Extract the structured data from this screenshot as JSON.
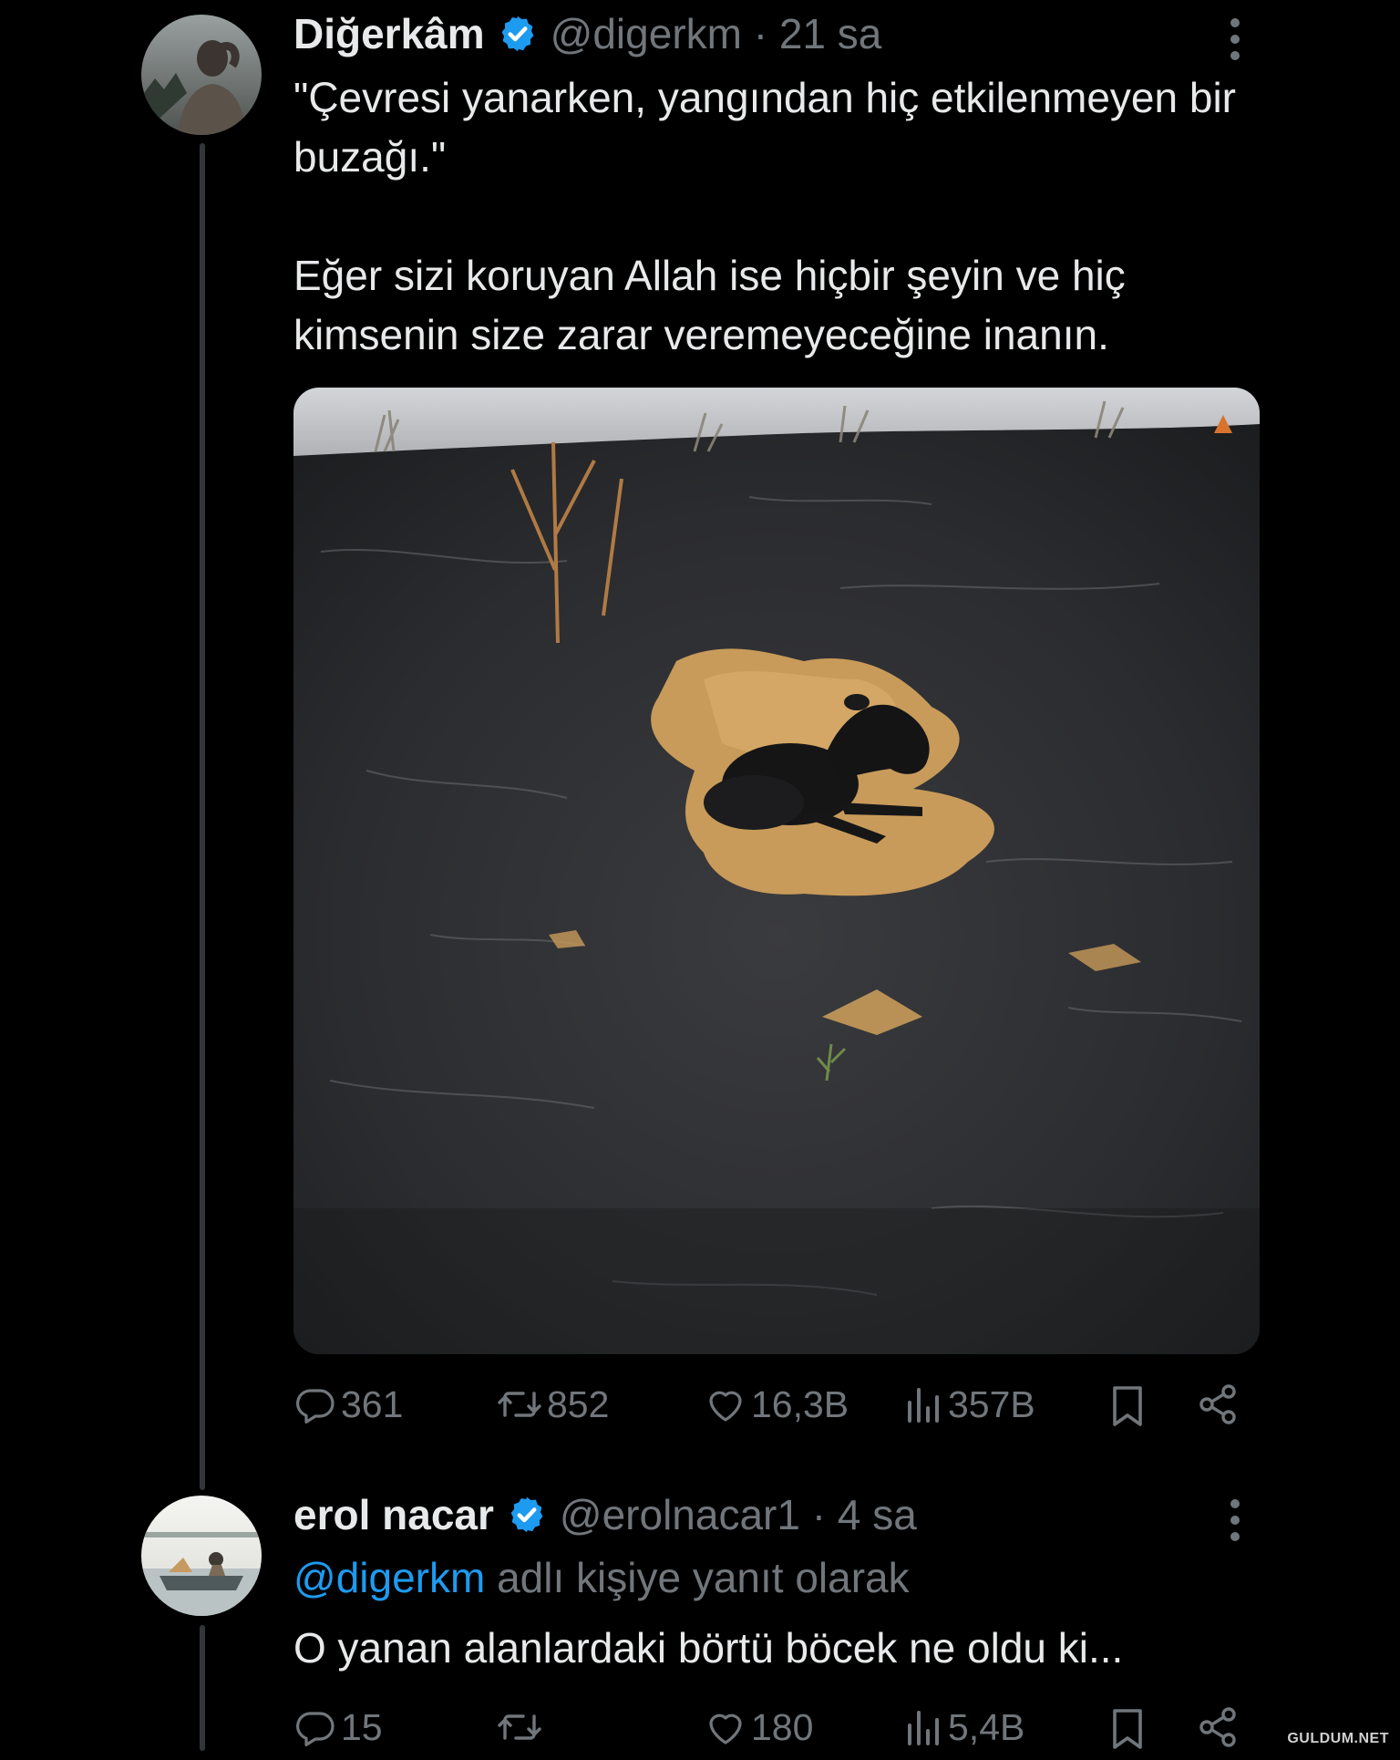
{
  "tweets": [
    {
      "display_name": "Diğerkâm",
      "handle_time": "@digerkm · 21 sa",
      "paragraphs": [
        "\"Çevresi yanarken, yangından hiç etkilenmeyen bir buzağı.\"",
        "Eğer sizi koruyan Allah ise hiçbir şeyin ve hiç kimsenin size zarar veremeyeceğine inanın."
      ],
      "media_icon": "burnt-field-calf-photo",
      "stats": {
        "replies": "361",
        "reposts": "852",
        "likes": "16,3B",
        "views": "357B"
      }
    },
    {
      "display_name": "erol nacar",
      "handle_time": "@erolnacar1 · 4 sa",
      "reply_to_mention": "@digerkm",
      "reply_to_suffix": " adlı kişiye yanıt olarak",
      "text": "O yanan alanlardaki börtü böcek ne oldu ki...",
      "stats": {
        "replies": "15",
        "reposts": "",
        "likes": "180",
        "views": "5,4B"
      }
    }
  ],
  "icons": {
    "verified": "verified-badge-icon",
    "more": "more-vertical-icon",
    "reply": "reply-icon",
    "repost": "repost-icon",
    "like": "heart-icon",
    "views": "views-icon",
    "bookmark": "bookmark-icon",
    "share": "share-icon"
  },
  "colors": {
    "background": "#000000",
    "text": "#e7e9ea",
    "muted": "#71767b",
    "accent": "#1d9bf0",
    "thread_line": "#333639"
  },
  "watermark": "GULDUM.NET"
}
